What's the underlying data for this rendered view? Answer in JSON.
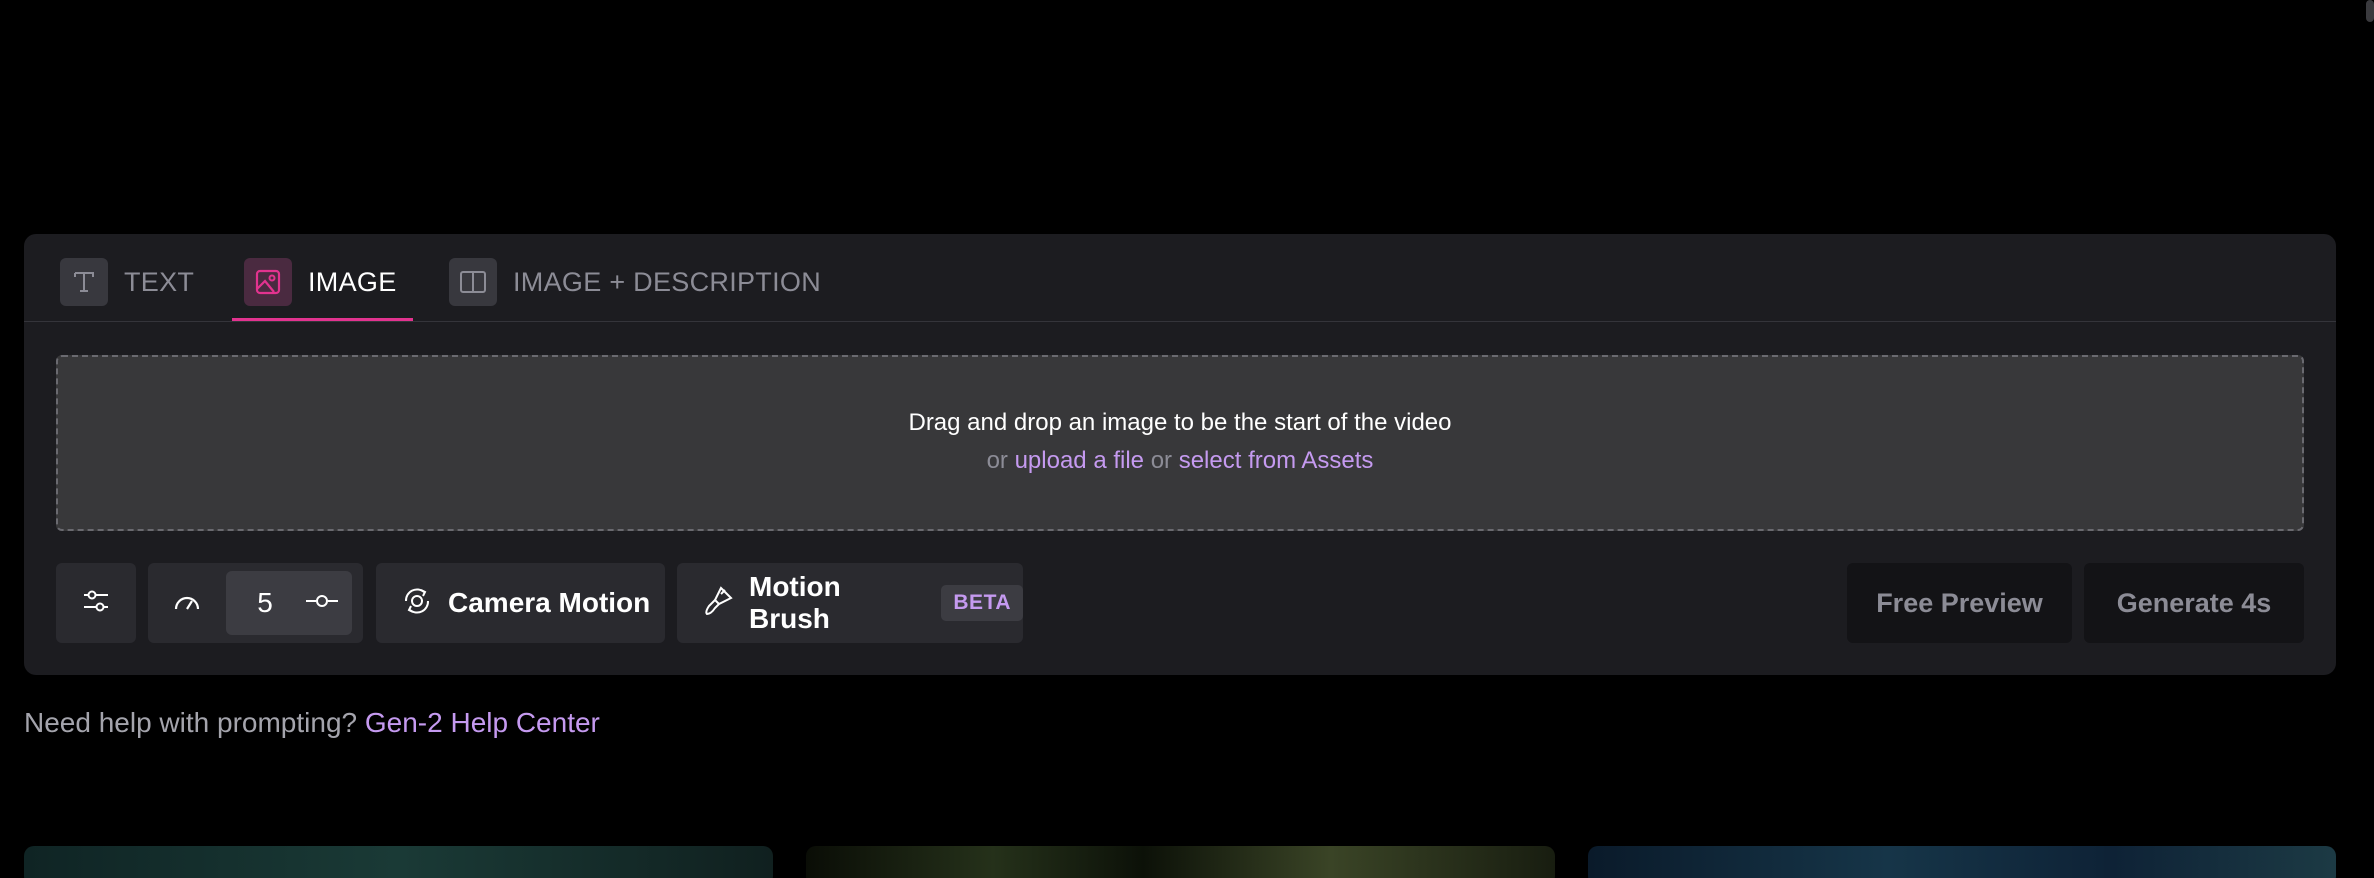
{
  "tabs": [
    {
      "label": "TEXT",
      "icon": "text-icon",
      "active": false
    },
    {
      "label": "IMAGE",
      "icon": "image-icon",
      "active": true
    },
    {
      "label": "IMAGE + DESCRIPTION",
      "icon": "split-layout-icon",
      "active": false
    }
  ],
  "dropzone": {
    "line1": "Drag and drop an image to be the start of the video",
    "or1": "or",
    "upload_link": "upload a file",
    "or2": "or",
    "assets_link": "select from Assets"
  },
  "toolbar": {
    "settings_icon": "sliders-icon",
    "speed_icon": "gauge-icon",
    "speed_value": "5",
    "speed_adjust_icon": "slider-handle-icon",
    "camera_motion_label": "Camera Motion",
    "camera_motion_icon": "camera-orbit-icon",
    "motion_brush_label": "Motion Brush",
    "motion_brush_icon": "brush-icon",
    "beta_badge": "BETA"
  },
  "actions": {
    "free_preview": "Free Preview",
    "generate": "Generate 4s"
  },
  "help": {
    "text": "Need help with prompting?",
    "link": "Gen-2 Help Center"
  },
  "colors": {
    "background": "#000000",
    "panel": "#1c1c20",
    "accent_pink": "#e2338f",
    "link_purple": "#c59af0",
    "muted_text": "#8c8c96"
  }
}
